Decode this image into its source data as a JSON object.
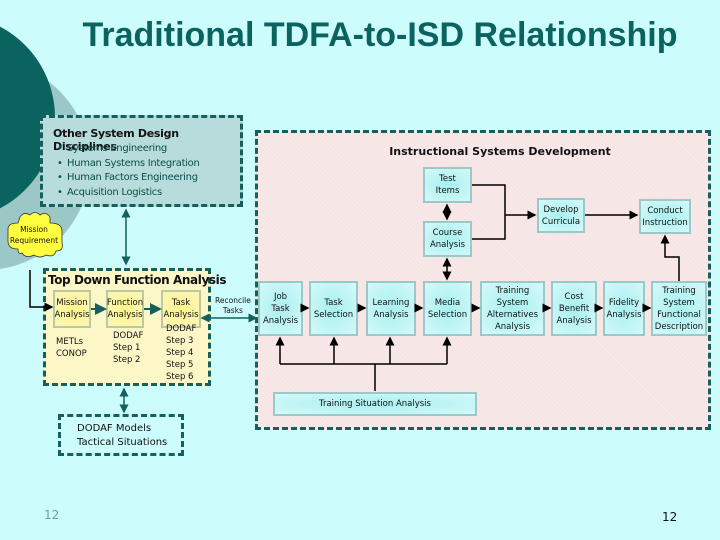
{
  "title": "Traditional TDFA-to-ISD Relationship",
  "other_disciplines": {
    "header": "Other System Design Disciplines",
    "items": [
      "Systems Engineering",
      "Human Systems Integration",
      "Human Factors Engineering",
      "Acquisition Logistics"
    ]
  },
  "mission_requirement": "Mission\nRequirement",
  "isd": {
    "header": "Instructional Systems Development",
    "test_items": "Test\nItems",
    "course_analysis": "Course\nAnalysis",
    "develop_curricula": "Develop\nCurricula",
    "conduct_instruction": "Conduct\nInstruction",
    "chain": [
      "Job\nTask\nAnalysis",
      "Task\nSelection",
      "Learning\nAnalysis",
      "Media\nSelection",
      "Training\nSystem\nAlternatives\nAnalysis",
      "Cost\nBenefit\nAnalysis",
      "Fidelity\nAnalysis",
      "Training\nSystem\nFunctional\nDescription"
    ],
    "training_situation": "Training Situation Analysis"
  },
  "tdfa": {
    "header": "Top Down Function Analysis",
    "mission_analysis": "Mission\nAnalysis",
    "function_analysis": "Function\nAnalysis",
    "task_analysis": "Task\nAnalysis",
    "mission_notes": "METLs\nCONOP",
    "function_notes": "DODAF\nStep 1\nStep 2",
    "task_notes": "DODAF\nStep 3\nStep 4\nStep 5\nStep 6"
  },
  "reconcile_label": "Reconcile\nTasks",
  "dodaf_models": "DODAF Models\nTactical Situations",
  "page_number_left": "12",
  "page_number_right": "12"
}
